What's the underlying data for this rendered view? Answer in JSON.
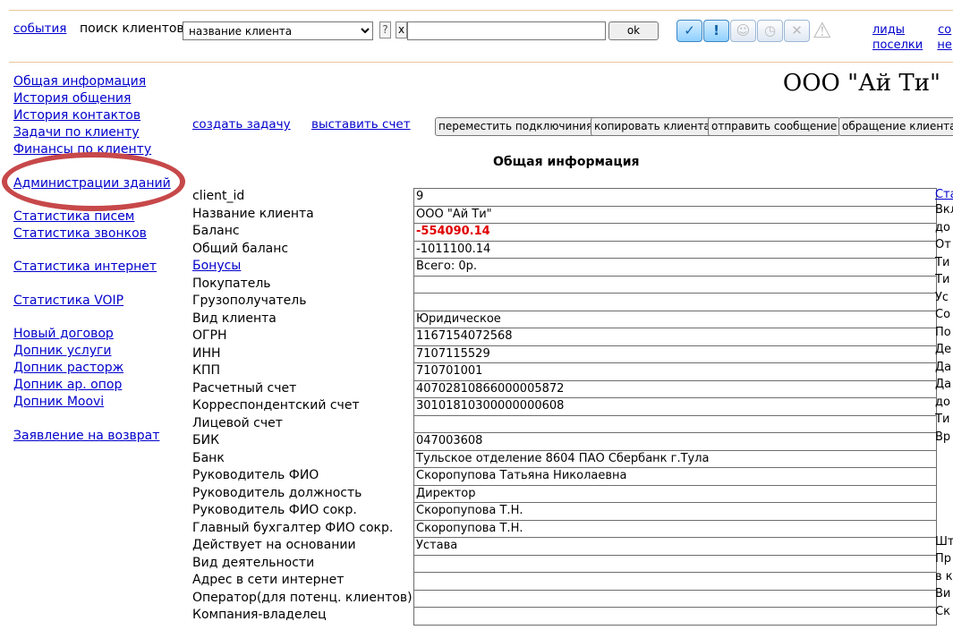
{
  "top_bar": {
    "events_link": "события",
    "search_label": "поиск клиентов",
    "search_field_select": "название клиента",
    "help_btn": "?",
    "clear_btn": "x",
    "search_value": "",
    "ok_btn": "ok",
    "icon_buttons": [
      "check-icon",
      "exclamation-icon",
      "smile-icon",
      "clock-icon",
      "cross-icon",
      "warning-icon"
    ],
    "right_links_row1": [
      "лиды",
      "со"
    ],
    "right_links_row2": [
      "поселки",
      "не"
    ]
  },
  "left_nav": {
    "group1": [
      "Общая информация",
      "История общения",
      "История контактов",
      "Задачи по клиенту",
      "Финансы по клиенту"
    ],
    "group2": [
      "Администрации зданий"
    ],
    "group3": [
      "Статистика писем",
      "Статистика звонков"
    ],
    "group4": [
      "Статистика интернет"
    ],
    "group5": [
      "Статистика VOIP"
    ],
    "group6": [
      "Новый договор",
      "Допник услуги",
      "Допник расторж",
      "Допник ар. опор",
      "Допник Moovi"
    ],
    "group7": [
      "Заявление на возврат"
    ]
  },
  "company_title": "ООО \"Ай Ти\"",
  "actions": {
    "create_task": "создать задачу",
    "issue_invoice": "выставить счет",
    "move_connections": "переместить подключиния",
    "copy_client": "копировать клиента",
    "send_message": "отправить сообщение",
    "client_request": "обращение клиента"
  },
  "section_heading": "Общая информация",
  "info_rows": [
    {
      "label": "client_id",
      "value": "9"
    },
    {
      "label": "Название клиента",
      "value": "ООО \"Ай Ти\""
    },
    {
      "label": "Баланс",
      "value": "-554090.14"
    },
    {
      "label": "Общий баланс",
      "value": "-1011100.14"
    },
    {
      "label": "Бонусы",
      "value": "Всего: 0р."
    },
    {
      "label": "Покупатель",
      "value": ""
    },
    {
      "label": "Грузополучатель",
      "value": ""
    },
    {
      "label": "Вид клиента",
      "value": "Юридическое"
    },
    {
      "label": "ОГРН",
      "value": "1167154072568"
    },
    {
      "label": "ИНН",
      "value": "7107115529"
    },
    {
      "label": "КПП",
      "value": "710701001"
    },
    {
      "label": "Расчетный счет",
      "value": "40702810866000005872"
    },
    {
      "label": "Корреспондентский счет",
      "value": "30101810300000000608"
    },
    {
      "label": "Лицевой счет",
      "value": ""
    },
    {
      "label": "БИК",
      "value": "047003608"
    },
    {
      "label": "Банк",
      "value": "Тульское отделение 8604 ПАО Сбербанк г.Тула"
    },
    {
      "label": "Руководитель ФИО",
      "value": "Скоропупова Татьяна Николаевна"
    },
    {
      "label": "Руководитель должность",
      "value": "Директор"
    },
    {
      "label": "Руководитель ФИО сокр.",
      "value": "Скоропупова Т.Н."
    },
    {
      "label": "Главный бухгалтер ФИО сокр.",
      "value": "Скоропупова Т.Н."
    },
    {
      "label": "Действует на основании",
      "value": "Устава"
    },
    {
      "label": "Вид деятельности",
      "value": ""
    },
    {
      "label": "Адрес в сети интернет",
      "value": ""
    },
    {
      "label": "Оператор(для потенц. клиентов)",
      "value": ""
    },
    {
      "label": "Компания-владелец",
      "value": ""
    }
  ],
  "right_column": [
    "Ста",
    "Вкл",
    "до",
    "От",
    "Ти",
    "Ти",
    "Ус",
    "Со",
    "По",
    "Де",
    "Да",
    "Да",
    "до",
    "Ти",
    "Вр",
    "",
    "",
    "",
    "",
    "",
    "Шт",
    "Пр",
    "в к",
    "Ви",
    "Ск"
  ],
  "colors": {
    "link": "#0000cc",
    "balance_negative": "#e00000",
    "annotation": "#c7484a"
  }
}
